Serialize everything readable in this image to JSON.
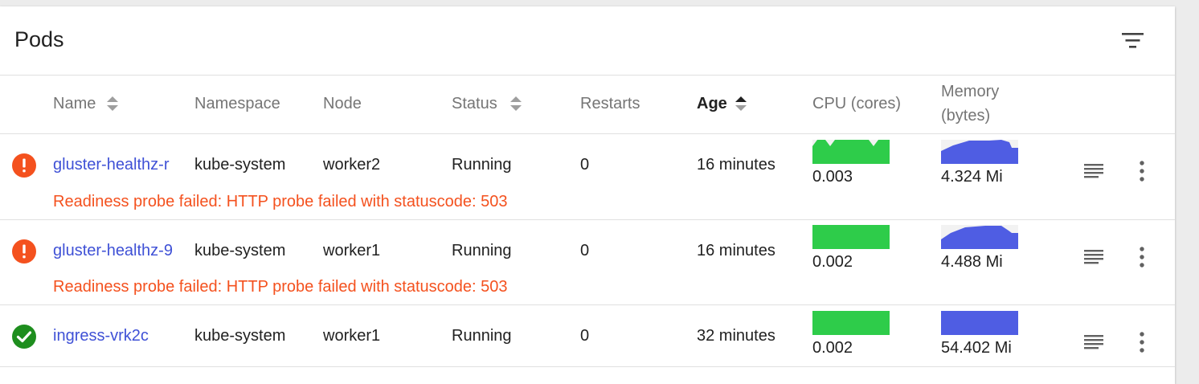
{
  "card": {
    "title": "Pods"
  },
  "columns": {
    "name": "Name",
    "namespace": "Namespace",
    "node": "Node",
    "status": "Status",
    "restarts": "Restarts",
    "age": "Age",
    "cpu": "CPU (cores)",
    "memory_line1": "Memory",
    "memory_line2": "(bytes)"
  },
  "sort": {
    "active_column": "age",
    "direction": "ascending"
  },
  "rows": [
    {
      "state": "error",
      "name": "gluster-healthz-r",
      "namespace": "kube-system",
      "node": "worker2",
      "status": "Running",
      "restarts": "0",
      "age": "16 minutes",
      "cpu": "0.003",
      "memory": "4.324 Mi",
      "error": "Readiness probe failed: HTTP probe failed with statuscode: 503"
    },
    {
      "state": "error",
      "name": "gluster-healthz-9",
      "namespace": "kube-system",
      "node": "worker1",
      "status": "Running",
      "restarts": "0",
      "age": "16 minutes",
      "cpu": "0.002",
      "memory": "4.488 Mi",
      "error": "Readiness probe failed: HTTP probe failed with statuscode: 503"
    },
    {
      "state": "ok",
      "name": "ingress-vrk2c",
      "namespace": "kube-system",
      "node": "worker1",
      "status": "Running",
      "restarts": "0",
      "age": "32 minutes",
      "cpu": "0.002",
      "memory": "54.402 Mi"
    }
  ],
  "colors": {
    "error": "#f4511e",
    "ok": "#1e8e1e",
    "link": "#3f51d6",
    "cpu_spark": "#2ecc4a",
    "memory_spark": "#4f5de3"
  },
  "icons": {
    "filter": "filter-icon",
    "error": "error-icon",
    "ok": "check-circle-icon",
    "logs": "logs-icon",
    "more": "more-vert-icon",
    "sort": "sort-icon"
  }
}
